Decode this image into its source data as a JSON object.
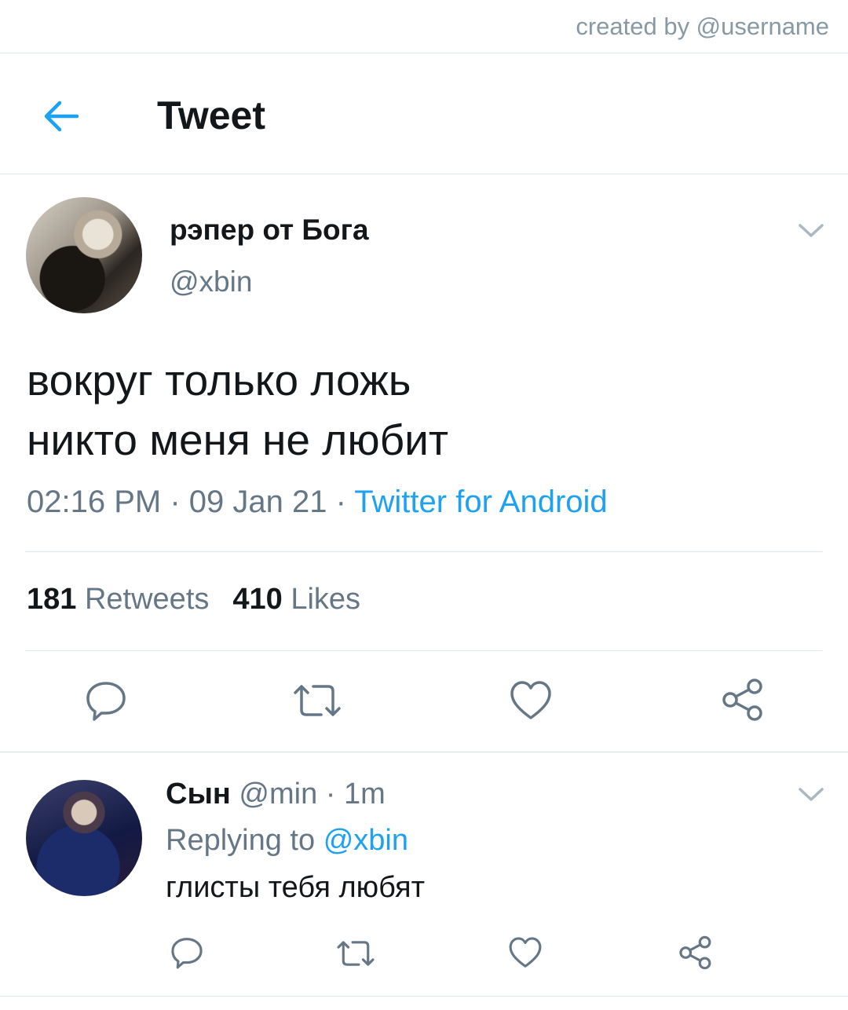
{
  "watermark": "created by @username",
  "header": {
    "title": "Tweet",
    "back_icon": "back-arrow-icon"
  },
  "tweet": {
    "display_name": "рэпер от Бога",
    "handle": "@xbin",
    "text_lines": [
      "вокруг только ложь",
      "никто меня не любит"
    ],
    "time": "02:16 PM",
    "date": "09 Jan 21",
    "source": "Twitter for Android",
    "separator": " · ",
    "retweets_count": "181",
    "retweets_label": "Retweets",
    "likes_count": "410",
    "likes_label": "Likes"
  },
  "reply": {
    "display_name": "Сын",
    "handle": "@min",
    "age": "1m",
    "separator": " · ",
    "replying_prefix": "Replying to",
    "replying_to": "@xbin",
    "text": "глисты тебя любят"
  },
  "actions": [
    "reply-icon",
    "retweet-icon",
    "like-icon",
    "share-icon"
  ],
  "colors": {
    "accent": "#1da1f2",
    "secondary_text": "#657786",
    "divider": "#e1e8ed"
  }
}
